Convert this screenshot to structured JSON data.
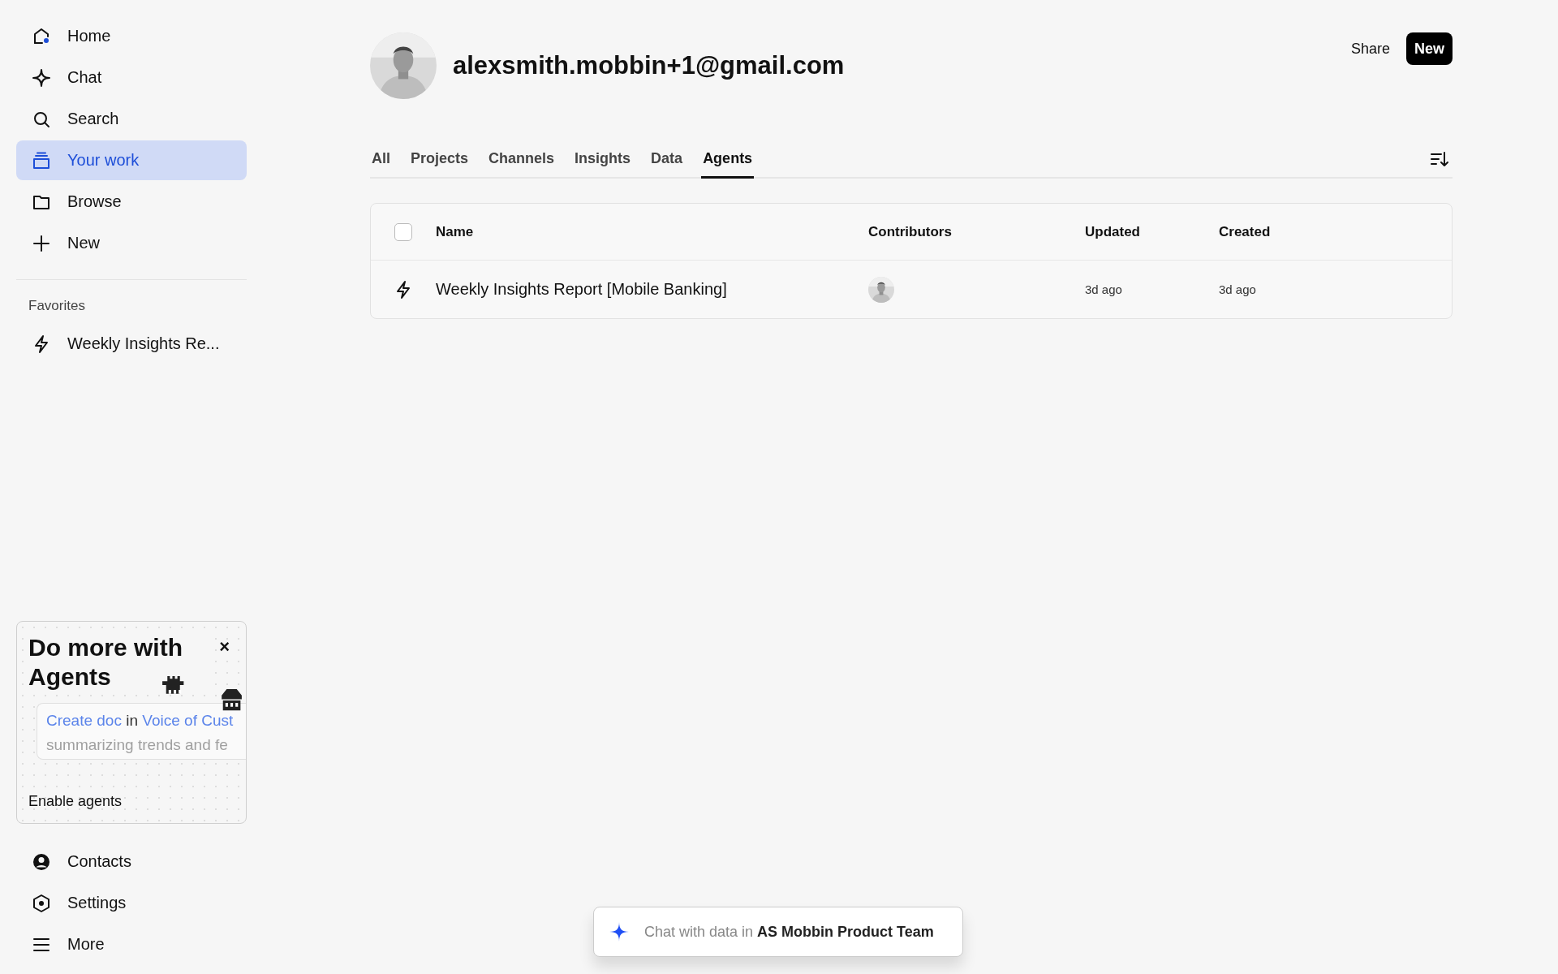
{
  "sidebar": {
    "nav": [
      {
        "label": "Home",
        "kind": "home",
        "selected": false
      },
      {
        "label": "Chat",
        "kind": "sparkle",
        "selected": false
      },
      {
        "label": "Search",
        "kind": "search",
        "selected": false
      },
      {
        "label": "Your work",
        "kind": "stack",
        "selected": true
      },
      {
        "label": "Browse",
        "kind": "folder",
        "selected": false
      },
      {
        "label": "New",
        "kind": "plus",
        "selected": false
      }
    ],
    "favorites": {
      "title": "Favorites",
      "items": [
        {
          "label": "Weekly Insights Re...",
          "kind": "bolt"
        }
      ]
    },
    "promo": {
      "title": "Do more with Agents",
      "close": "×",
      "preview": {
        "action": "Create doc",
        "joiner": "in",
        "target": "Voice of Cust",
        "body": "summarizing trends and fe"
      },
      "button": "Enable agents"
    },
    "bottom_nav": [
      {
        "label": "Contacts",
        "kind": "person"
      },
      {
        "label": "Settings",
        "kind": "hexagon"
      },
      {
        "label": "More",
        "kind": "menu"
      }
    ]
  },
  "header": {
    "title": "alexsmith.mobbin+1@gmail.com",
    "actions": [
      {
        "label": "Share",
        "kind": "plain"
      },
      {
        "label": "New",
        "kind": "primary"
      }
    ]
  },
  "tabs": [
    {
      "label": "All",
      "selected": false
    },
    {
      "label": "Projects",
      "selected": false
    },
    {
      "label": "Channels",
      "selected": false
    },
    {
      "label": "Insights",
      "selected": false
    },
    {
      "label": "Data",
      "selected": false
    },
    {
      "label": "Agents",
      "selected": true
    }
  ],
  "table": {
    "select_all": {
      "checked": false
    },
    "columns": [
      "Name",
      "Contributors",
      "Updated",
      "Created"
    ],
    "rows": [
      {
        "kind": "bolt",
        "name": "Weekly Insights Report [Mobile Banking]",
        "updated": "3d ago",
        "created": "3d ago"
      }
    ]
  },
  "chat_bar": {
    "text": "Chat with data in **AS Mobbin Product Team**"
  }
}
